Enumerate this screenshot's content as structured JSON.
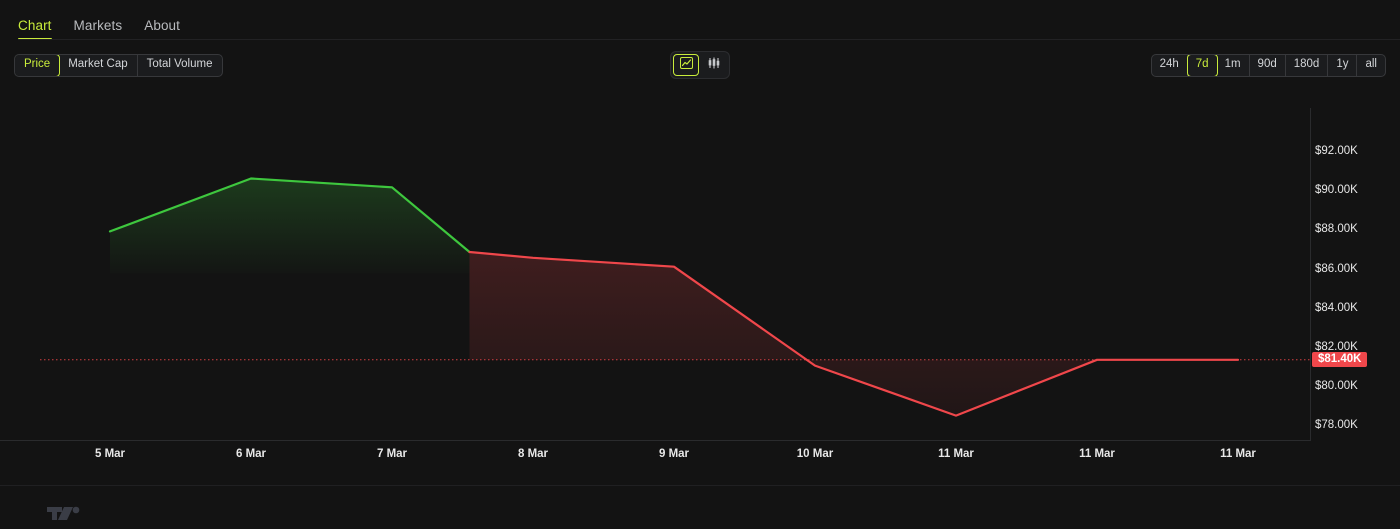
{
  "tabs": [
    {
      "label": "Chart",
      "active": true
    },
    {
      "label": "Markets",
      "active": false
    },
    {
      "label": "About",
      "active": false
    }
  ],
  "metric_toggle": {
    "items": [
      {
        "label": "Price",
        "active": true
      },
      {
        "label": "Market Cap",
        "active": false
      },
      {
        "label": "Total Volume",
        "active": false
      }
    ]
  },
  "chart_type_toggle": {
    "items": [
      {
        "icon": "line-chart-icon",
        "active": true
      },
      {
        "icon": "candlestick-chart-icon",
        "active": false
      }
    ]
  },
  "range_selector": {
    "items": [
      {
        "label": "24h",
        "active": false
      },
      {
        "label": "7d",
        "active": true
      },
      {
        "label": "1m",
        "active": false
      },
      {
        "label": "90d",
        "active": false
      },
      {
        "label": "180d",
        "active": false
      },
      {
        "label": "1y",
        "active": false
      },
      {
        "label": "all",
        "active": false
      }
    ]
  },
  "attribution": {
    "logo": "tradingview-logo"
  },
  "colors": {
    "accent": "#c9ec3b",
    "up_line": "#3ec73e",
    "down_line": "#f0474b",
    "background": "#131313",
    "badge_bg": "#f0474b"
  },
  "chart_data": {
    "type": "line",
    "title": "",
    "xlabel": "",
    "ylabel": "",
    "ylim": [
      77000,
      93000
    ],
    "grid": false,
    "legend": false,
    "current_price_label": "$81.40K",
    "current_price_value": 81400,
    "reference_line": {
      "value": 81400,
      "style": "dotted",
      "color": "#f0474b"
    },
    "ytick_labels": [
      "$92.00K",
      "$90.00K",
      "$88.00K",
      "$86.00K",
      "$84.00K",
      "$82.00K",
      "$80.00K",
      "$78.00K"
    ],
    "ytick_values": [
      92000,
      90000,
      88000,
      86000,
      84000,
      82000,
      80000,
      78000
    ],
    "xtick_labels": [
      "5 Mar",
      "6 Mar",
      "7 Mar",
      "8 Mar",
      "9 Mar",
      "10 Mar",
      "11 Mar",
      "11 Mar",
      "11 Mar"
    ],
    "x": [
      0,
      1,
      2,
      3,
      4,
      5,
      6,
      7,
      8
    ],
    "values": [
      87950,
      90650,
      90200,
      86600,
      86150,
      81100,
      78550,
      81400,
      81400
    ],
    "series": [
      {
        "name": "Price",
        "segments": [
          {
            "color_key": "up_line",
            "points": [
              [
                0,
                87950
              ],
              [
                1,
                90650
              ],
              [
                2,
                90200
              ],
              [
                2.55,
                86900
              ]
            ]
          },
          {
            "color_key": "down_line",
            "points": [
              [
                2.55,
                86900
              ],
              [
                3,
                86600
              ],
              [
                4,
                86150
              ],
              [
                5,
                81100
              ],
              [
                6,
                78550
              ],
              [
                7,
                81400
              ],
              [
                8,
                81400
              ]
            ]
          }
        ]
      }
    ]
  }
}
